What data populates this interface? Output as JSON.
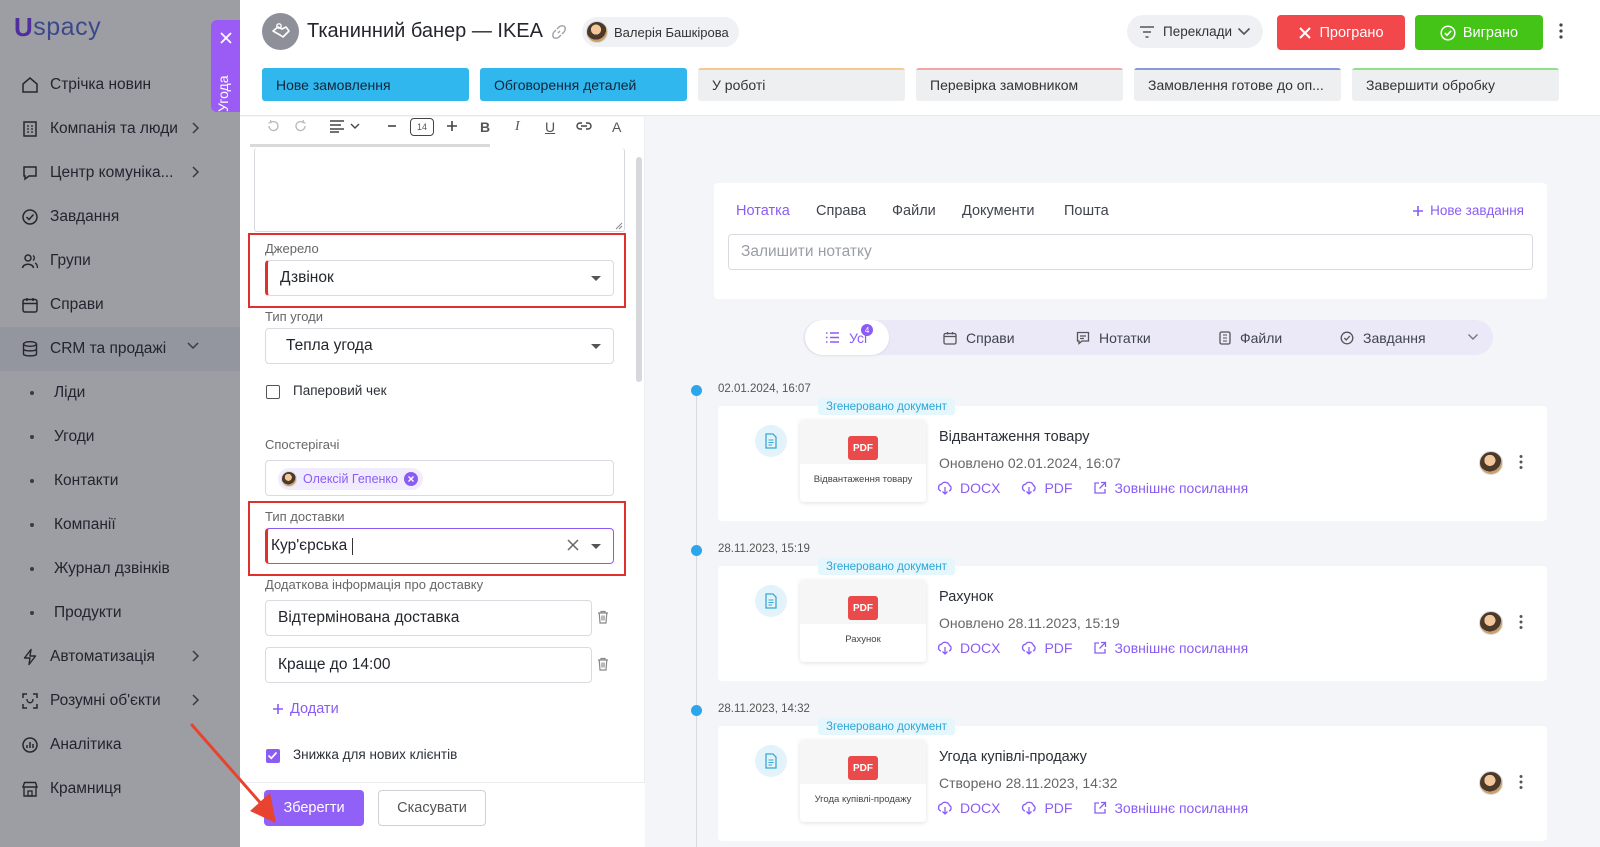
{
  "app": {
    "logo_letter": "U",
    "logo_text": "spacy"
  },
  "sidebar": {
    "items": [
      {
        "label": "Стрічка новин",
        "icon": "news-feed-icon",
        "chevron": false,
        "sub": false
      },
      {
        "label": "Компанія та люди",
        "icon": "company-icon",
        "chevron": true,
        "sub": false
      },
      {
        "label": "Центр комуніка...",
        "icon": "communication-icon",
        "chevron": true,
        "sub": false
      },
      {
        "label": "Завдання",
        "icon": "tasks-icon",
        "chevron": false,
        "sub": false
      },
      {
        "label": "Групи",
        "icon": "groups-icon",
        "chevron": false,
        "sub": false
      },
      {
        "label": "Справи",
        "icon": "calendar-icon",
        "chevron": false,
        "sub": false
      },
      {
        "label": "CRM та продажі",
        "icon": "crm-database-icon",
        "chevron": true,
        "sub": false
      },
      {
        "label": "Ліди",
        "sub": true
      },
      {
        "label": "Угоди",
        "sub": true
      },
      {
        "label": "Контакти",
        "sub": true
      },
      {
        "label": "Компанії",
        "sub": true
      },
      {
        "label": "Журнал дзвінків",
        "sub": true
      },
      {
        "label": "Продукти",
        "sub": true
      },
      {
        "label": "Автоматизація",
        "icon": "lightning-icon",
        "chevron": true,
        "sub": false
      },
      {
        "label": "Розумні об'єкти",
        "icon": "smart-object-icon",
        "chevron": true,
        "sub": false
      },
      {
        "label": "Аналітика",
        "icon": "analytics-icon",
        "chevron": false,
        "sub": false
      },
      {
        "label": "Крамниця",
        "icon": "store-icon",
        "chevron": false,
        "sub": false
      }
    ]
  },
  "deal_tab": {
    "label": "Угода"
  },
  "header": {
    "title": "Тканинний банер — IKEA",
    "owner": "Валерія Башкірова",
    "translate_label": "Переклади",
    "lost_label": "Програно",
    "won_label": "Виграно"
  },
  "stages": [
    {
      "label": "Нове замовлення",
      "active": true,
      "color": "#2fb7ee"
    },
    {
      "label": "Обговорення деталей",
      "active": true,
      "color": "#2fb7ee"
    },
    {
      "label": "У роботі",
      "active": false,
      "color": "#f5c98e"
    },
    {
      "label": "Перевірка замовником",
      "active": false,
      "color": "#f3a4a4"
    },
    {
      "label": "Замовлення готове до оп...",
      "active": false,
      "color": "#8a97d9"
    },
    {
      "label": "Завершити обробку",
      "active": false,
      "color": "#8ee08a"
    }
  ],
  "editor": {
    "font_size": "14"
  },
  "form": {
    "source_label": "Джерело",
    "source_value": "Дзвінок",
    "deal_type_label": "Тип угоди",
    "deal_type_value": "Тепла угода",
    "paper_check_label": "Паперовий чек",
    "paper_check_checked": false,
    "observers_label": "Спостерігачі",
    "observer_name": "Олексій Гепенко",
    "delivery_label": "Тип доставки",
    "delivery_value": "Кур'єрська",
    "delivery_info_label": "Додаткова інформація про доставку",
    "delivery_info_values": [
      "Відтермінована доставка",
      "Краще до 14:00"
    ],
    "add_label": "Додати",
    "discount_label": "Знижка для нових клієнтів",
    "discount_checked": true,
    "save_label": "Зберегти",
    "cancel_label": "Скасувати"
  },
  "note_card": {
    "tabs": [
      "Нотатка",
      "Справа",
      "Файли",
      "Документи",
      "Пошта"
    ],
    "active_tab": "Нотатка",
    "new_task_label": "Нове завдання",
    "note_placeholder": "Залишити нотатку"
  },
  "filters": {
    "items": [
      {
        "label": "Усі",
        "icon": "list-icon",
        "badge": "4"
      },
      {
        "label": "Справи",
        "icon": "calendar-icon"
      },
      {
        "label": "Нотатки",
        "icon": "note-icon"
      },
      {
        "label": "Файли",
        "icon": "file-icon"
      },
      {
        "label": "Завдання",
        "icon": "task-check-icon"
      }
    ]
  },
  "timeline": [
    {
      "date": "02.01.2024, 16:07",
      "badge": "Згенеровано документ",
      "thumb_tag": "PDF",
      "thumb_caption": "Відвантаження товару",
      "name": "Відвантаження товару",
      "updated": "Оновлено 02.01.2024, 16:07",
      "links": [
        "DOCX",
        "PDF",
        "Зовнішнє посилання"
      ]
    },
    {
      "date": "28.11.2023, 15:19",
      "badge": "Згенеровано документ",
      "thumb_tag": "PDF",
      "thumb_caption": "Рахунок",
      "name": "Рахунок",
      "updated": "Оновлено 28.11.2023, 15:19",
      "links": [
        "DOCX",
        "PDF",
        "Зовнішнє посилання"
      ]
    },
    {
      "date": "28.11.2023, 14:32",
      "badge": "Згенеровано документ",
      "thumb_tag": "PDF",
      "thumb_caption": "Угода купівлі-продажу",
      "name": "Угода купівлі-продажу",
      "updated": "Створено 28.11.2023, 14:32",
      "links": [
        "DOCX",
        "PDF",
        "Зовнішнє посилання"
      ]
    }
  ],
  "colors": {
    "accent": "#8a5cf5",
    "lost": "#f2484c",
    "won": "#44c417",
    "stage_active": "#2fb7ee",
    "highlight": "#e0302c",
    "timeline_dot": "#2aa6ef"
  }
}
